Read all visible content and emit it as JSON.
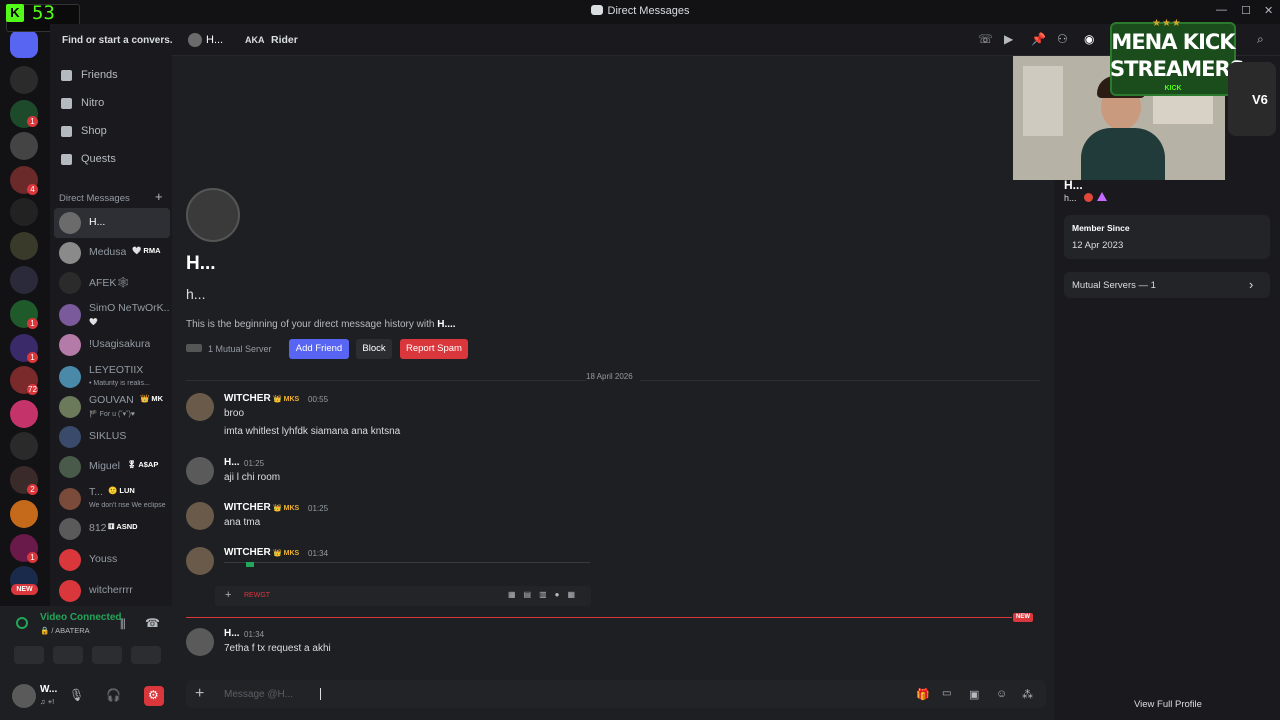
{
  "window": {
    "title": "Direct Messages"
  },
  "overlay": {
    "counter_value": "53",
    "counter_k": "K",
    "logo_line1": "MENA KICK",
    "logo_line2": "STREAMERS",
    "logo_sub": "KICK",
    "logo_side": "V6"
  },
  "sidebar": {
    "search_text": "Find or start a convers...",
    "nav": [
      {
        "label": "Friends",
        "icon": "friends-icon"
      },
      {
        "label": "Nitro",
        "icon": "nitro-icon"
      },
      {
        "label": "Shop",
        "icon": "shop-icon"
      },
      {
        "label": "Quests",
        "icon": "quests-icon"
      }
    ],
    "dm_header": "Direct Messages",
    "dm_plus": "+",
    "dms": [
      {
        "name": "H...",
        "tag": "",
        "sub": "",
        "active": true,
        "color": "#6b6b6b"
      },
      {
        "name": "Medusa",
        "tag": "🤍 RMA",
        "sub": "",
        "active": false,
        "color": "#8a8a8a"
      },
      {
        "name": "AFEK🕸",
        "tag": "",
        "sub": "",
        "active": false,
        "color": "#2b2b2b"
      },
      {
        "name": "SimO NeTwOrK...",
        "tag": "",
        "sub": "🤍",
        "active": false,
        "color": "#7a5a9a"
      },
      {
        "name": "!Usagisakura",
        "tag": "",
        "sub": "",
        "active": false,
        "color": "#b47aa8"
      },
      {
        "name": "LEYEOTIIX",
        "tag": "",
        "sub": "• Maturity is realis...",
        "active": false,
        "color": "#4a8aa8"
      },
      {
        "name": "GOUVAN",
        "tag": "👑 MK",
        "sub": "🏴 For u (˘▾˘)♥",
        "active": false,
        "color": "#6a7a5a"
      },
      {
        "name": "SIKLUS",
        "tag": "",
        "sub": "",
        "active": false,
        "color": "#3a4a6a"
      },
      {
        "name": "Miguel",
        "tag": "🎖 A$AP",
        "sub": "",
        "active": false,
        "color": "#4a5a4a"
      },
      {
        "name": "T...",
        "tag": "🙂 LUN",
        "sub": "We don't rise We eclipse",
        "active": false,
        "color": "#7a4a3a"
      },
      {
        "name": "812",
        "tag": "⚅ ASND",
        "sub": "",
        "active": false,
        "color": "#5a5a5a"
      },
      {
        "name": "Youss",
        "tag": "",
        "sub": "",
        "active": false,
        "color": "#da373c"
      },
      {
        "name": "witcherrrr",
        "tag": "",
        "sub": "",
        "active": false,
        "color": "#da373c"
      }
    ],
    "voice_status": "Video Connected",
    "voice_channel": "🔒 / ABATERA",
    "user_name": "W...",
    "user_sub": "♫ +!"
  },
  "header": {
    "dm_name": "H...",
    "aka_label": "AKA",
    "aka_value": "Rider"
  },
  "chat": {
    "intro_name": "H...",
    "intro_username": "h...",
    "intro_text": "This is the beginning of your direct message history with ",
    "intro_bold": "H....",
    "mutual_server": "1 Mutual Server",
    "add_friend": "Add Friend",
    "block": "Block",
    "report_spam": "Report Spam",
    "date_divider": "18 April 2026",
    "new_label": "NEW",
    "composer_placeholder": "Message @H...",
    "attachment_label": "REWGT",
    "messages": [
      {
        "author": "WITCHER",
        "badge": "👑 MKS",
        "time": "00:55",
        "lines": [
          "broo",
          "imta whitlest lyhfdk siamana ana kntsna"
        ]
      },
      {
        "author": "H...",
        "badge": "",
        "time": "01:25",
        "lines": [
          "aji l chi room"
        ]
      },
      {
        "author": "WITCHER",
        "badge": "👑 MKS",
        "time": "01:25",
        "lines": [
          "ana tma"
        ]
      },
      {
        "author": "WITCHER",
        "badge": "👑 MKS",
        "time": "01:34",
        "lines": []
      },
      {
        "author": "H...",
        "badge": "",
        "time": "01:34",
        "lines": [
          "7etha f tx request a akhi"
        ]
      }
    ]
  },
  "profile": {
    "name_partial": "H...",
    "username": "h...",
    "member_since_label": "Member Since",
    "member_since_value": "12 Apr 2023",
    "mutual_servers": "Mutual Servers — 1",
    "view_full": "View Full Profile"
  },
  "colors": {
    "accent": "#5865f2",
    "danger": "#da373c",
    "kick": "#53fc18"
  }
}
